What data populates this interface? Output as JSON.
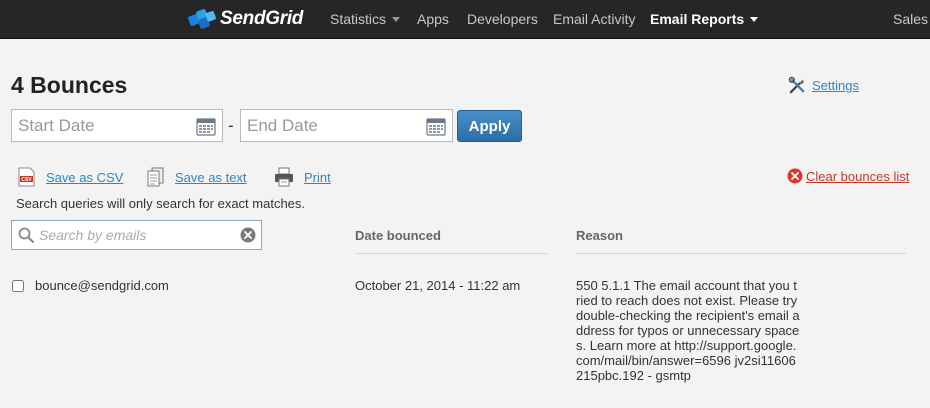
{
  "nav": {
    "brand": "SendGrid",
    "items": [
      {
        "label": "Statistics",
        "has_caret": true
      },
      {
        "label": "Apps"
      },
      {
        "label": "Developers"
      },
      {
        "label": "Email Activity"
      },
      {
        "label": "Email Reports",
        "has_caret": true,
        "active": true
      },
      {
        "label": "Sales"
      }
    ]
  },
  "page": {
    "title": "4 Bounces",
    "settings_label": "Settings"
  },
  "filters": {
    "start_placeholder": "Start Date",
    "end_placeholder": "End Date",
    "separator": "-",
    "apply_label": "Apply"
  },
  "actions": {
    "save_csv": "Save as CSV",
    "save_text": "Save as text",
    "print": "Print",
    "clear_bounces": "Clear bounces list"
  },
  "search": {
    "note": "Search queries will only search for exact matches.",
    "placeholder": "Search by emails"
  },
  "table": {
    "headers": {
      "date": "Date bounced",
      "reason": "Reason"
    },
    "rows": [
      {
        "email": "bounce@sendgrid.com",
        "date": "October 21, 2014 - 11:22 am",
        "reason": "550 5.1.1 The email account that you tried to reach does not exist. Please try double-checking the recipient's email address for typos or unnecessary spaces. Learn more at http://support.google.com/mail/bin/answer=6596 jv2si11606215pbc.192 - gsmtp",
        "checked": false
      }
    ]
  },
  "colors": {
    "nav_bg": "#262626",
    "link": "#2f85c7",
    "apply_button": "#2c6da6",
    "danger": "#c0392b"
  }
}
